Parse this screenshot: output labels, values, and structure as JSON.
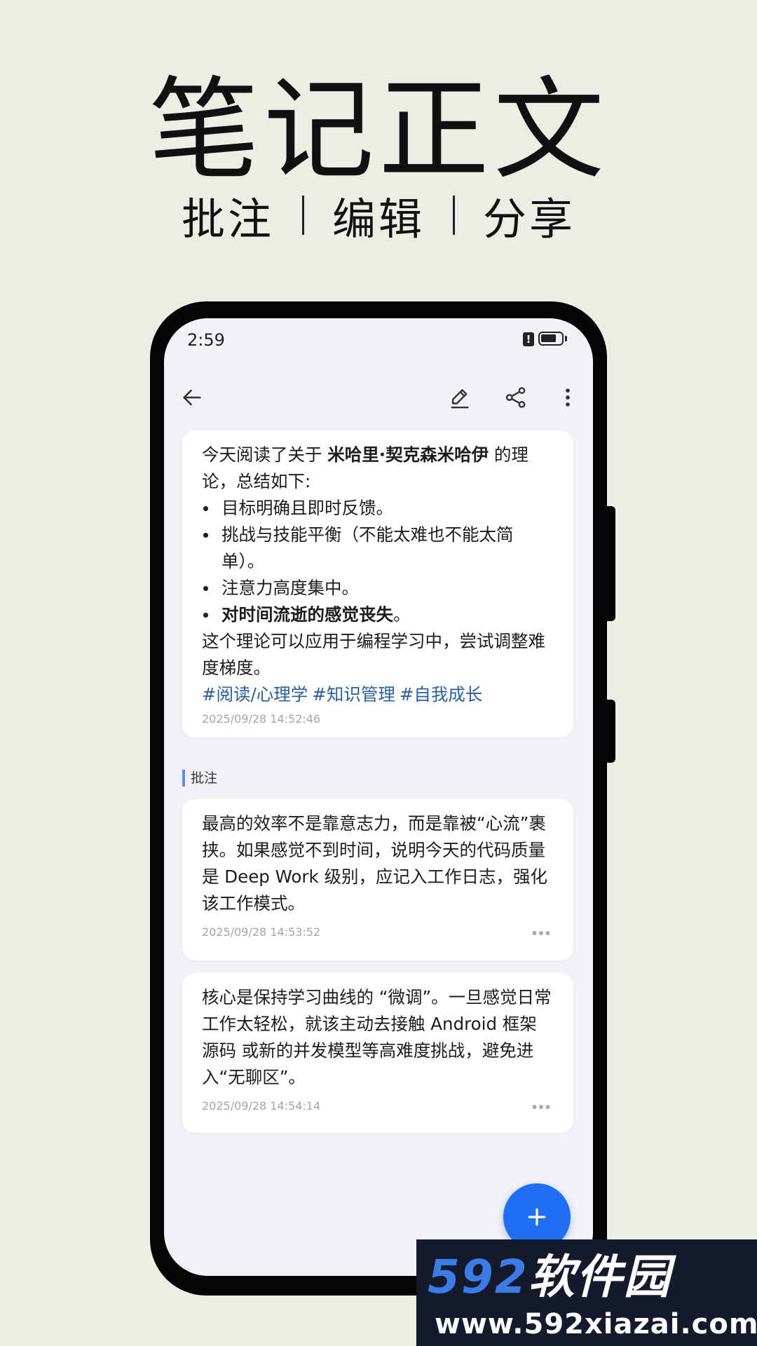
{
  "hero": {
    "title": "笔记正文",
    "subtitle": [
      "批注",
      "编辑",
      "分享"
    ]
  },
  "status_bar": {
    "time": "2:59",
    "alert_glyph": "!"
  },
  "toolbar": {
    "back_icon": "arrow-left-icon",
    "edit_icon": "pencil-icon",
    "share_icon": "share-icon",
    "more_icon": "more-vertical-icon"
  },
  "note": {
    "intro_prefix": "今天阅读了关于 ",
    "intro_bold": "米哈里·契克森米哈伊",
    "intro_suffix": " 的理论，总结如下:",
    "bullets": [
      "目标明确且即时反馈。",
      "挑战与技能平衡（不能太难也不能太简单）。",
      "注意力高度集中。"
    ],
    "bullet_bold": "对时间流逝的感觉丧失",
    "bullet_bold_suffix": "。",
    "outro": "这个理论可以应用于编程学习中，尝试调整难度梯度。",
    "tags": [
      "#阅读/心理学",
      "#知识管理",
      "#自我成长"
    ],
    "timestamp": "2025/09/28 14:52:46"
  },
  "annotations": {
    "section_label": "批注",
    "items": [
      {
        "text": "最高的效率不是靠意志力，而是靠被“心流”裹挟。如果感觉不到时间，说明今天的代码质量是 Deep Work 级别，应记入工作日志，强化该工作模式。",
        "timestamp": "2025/09/28 14:53:52"
      },
      {
        "text": "核心是保持学习曲线的 “微调”。一旦感觉日常工作太轻松，就该主动去接触 Android 框架源码 或新的并发模型等高难度挑战，避免进入“无聊区”。",
        "timestamp": "2025/09/28 14:54:14"
      }
    ]
  },
  "fab": {
    "icon": "plus-icon"
  },
  "watermark": {
    "logo_number": "592",
    "logo_text": "软件园",
    "url": "www.592xiazai.com"
  },
  "colors": {
    "accent": "#1f6ff2",
    "tag": "#2a5f9e",
    "section_bar": "#5b8fe3",
    "background": "#edede6",
    "screen": "#f1f1f6"
  }
}
